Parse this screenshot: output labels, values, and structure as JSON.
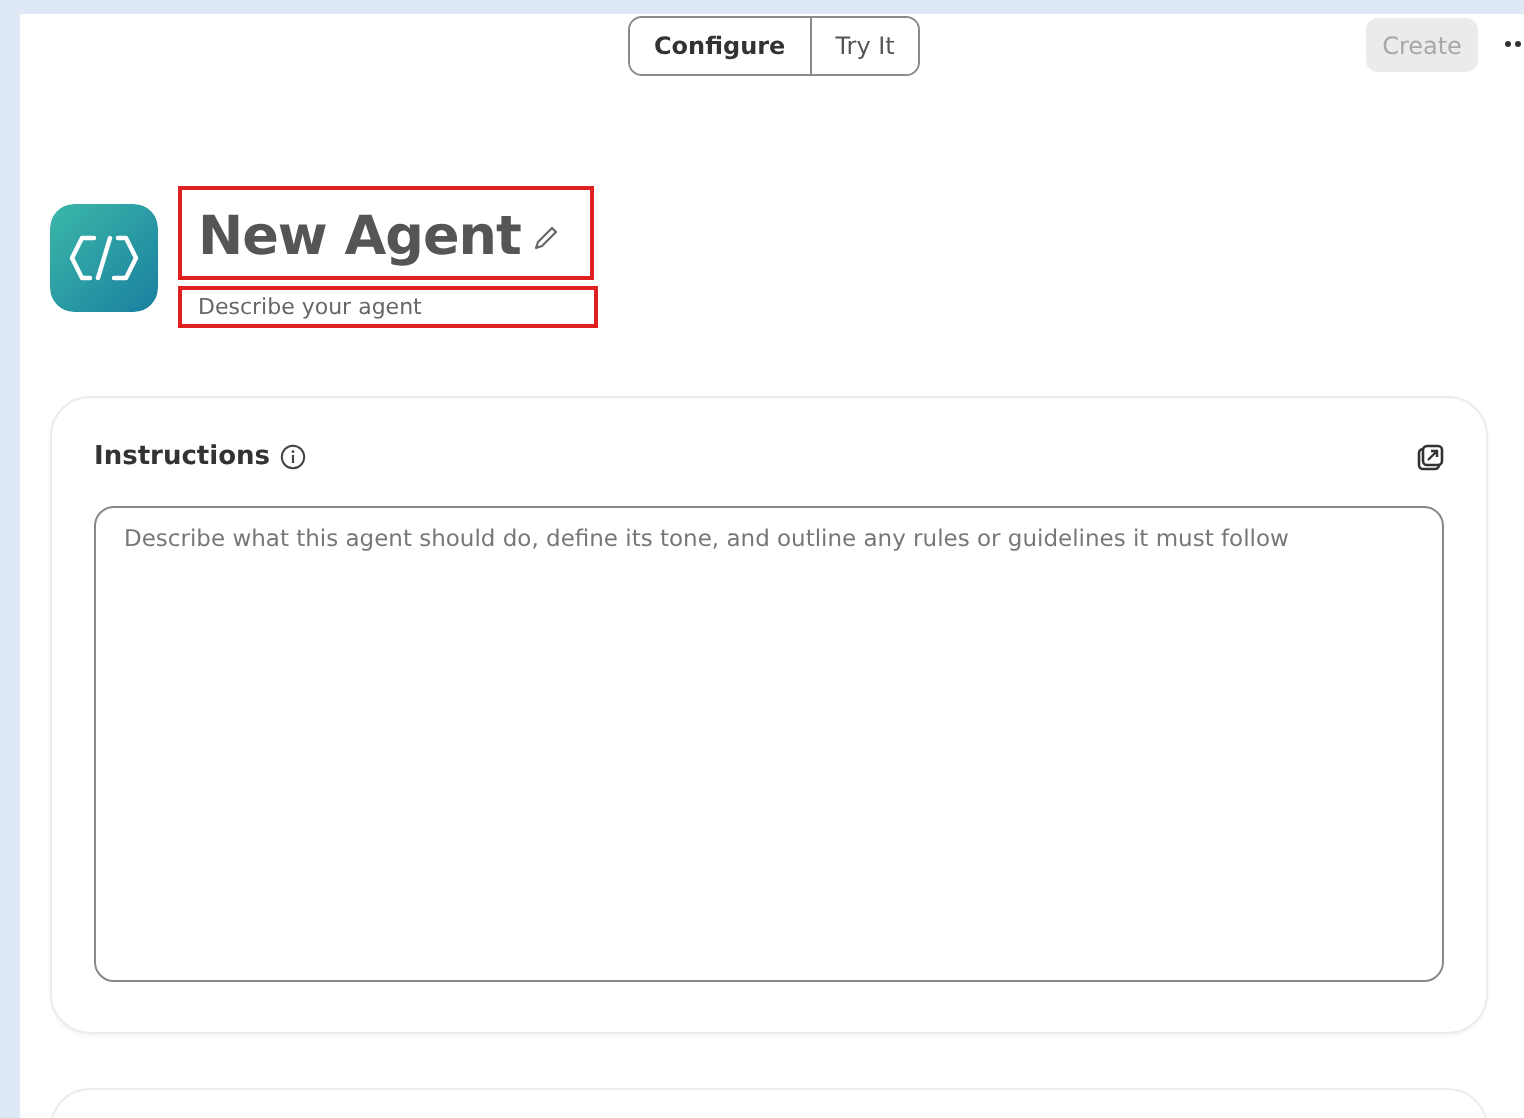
{
  "tabs": [
    {
      "label": "Configure",
      "selected": true
    },
    {
      "label": "Try It",
      "selected": false
    }
  ],
  "create_button": {
    "label": "Create",
    "disabled": true
  },
  "agent": {
    "name": "New Agent",
    "name_highlighted": true,
    "description_placeholder": "Describe your agent",
    "description_highlighted": true
  },
  "instructions": {
    "label": "Instructions",
    "placeholder": "Describe what this agent should do, define its tone, and outline any rules or guidelines it must follow"
  }
}
